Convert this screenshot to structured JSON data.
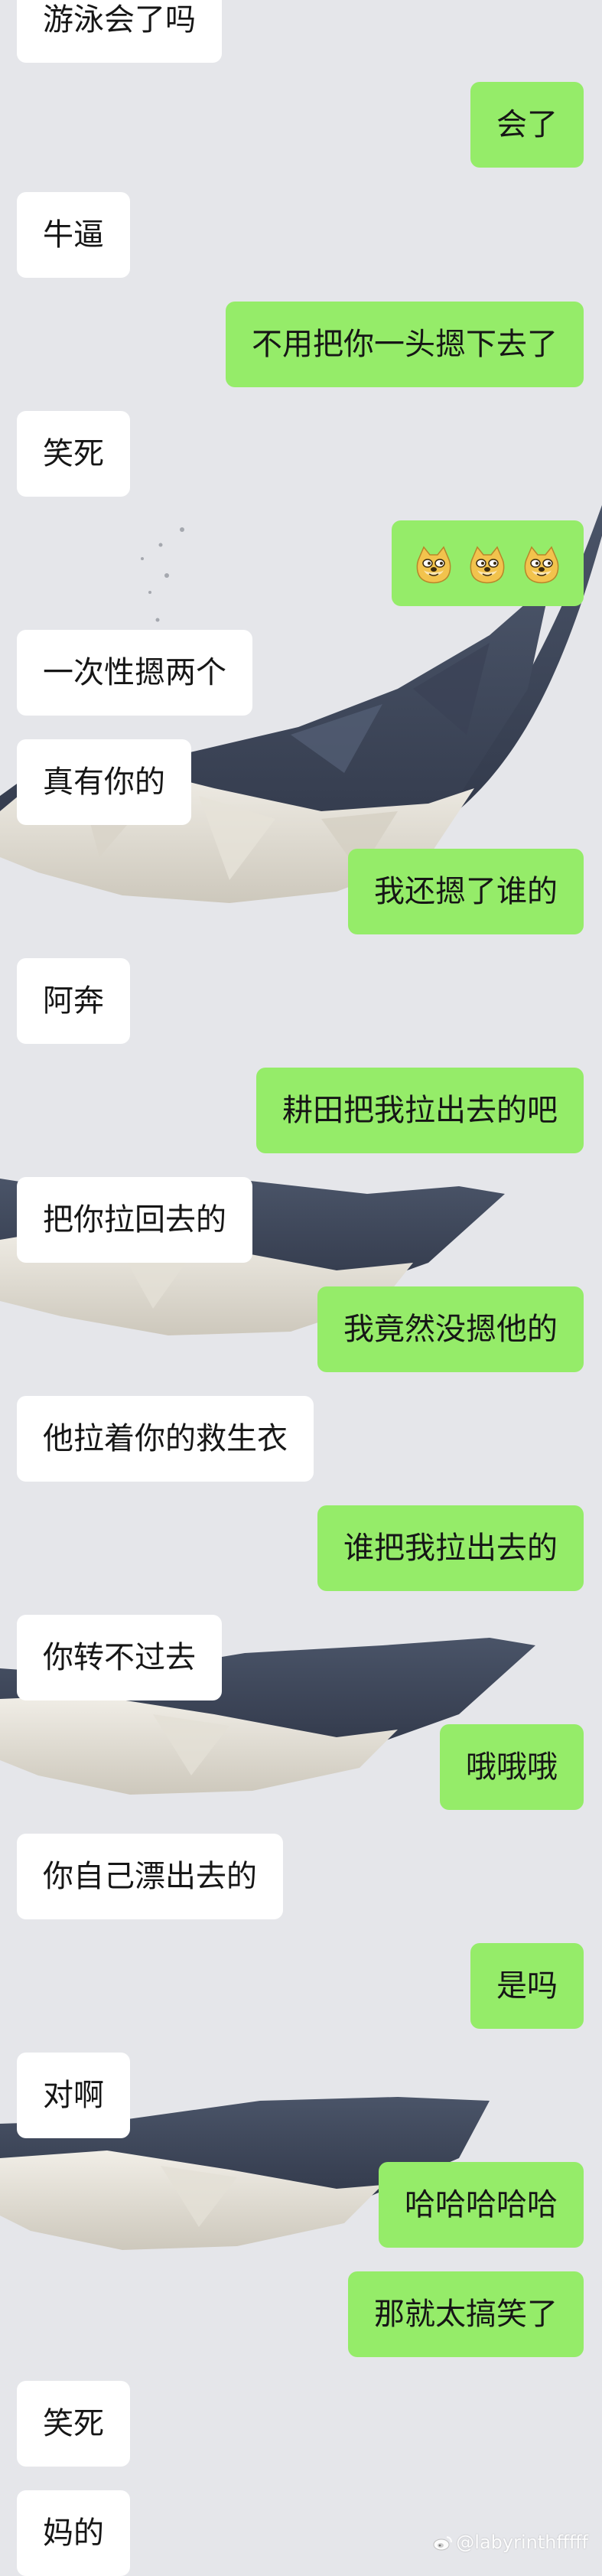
{
  "conversation": {
    "messages": [
      {
        "side": "left",
        "text": "游泳会了吗"
      },
      {
        "side": "right",
        "text": "会了"
      },
      {
        "side": "left",
        "text": "牛逼"
      },
      {
        "side": "right",
        "text": "不用把你一头摁下去了"
      },
      {
        "side": "left",
        "text": "笑死"
      },
      {
        "side": "right",
        "text": "",
        "emoji": [
          "doge-emoji",
          "doge-emoji",
          "doge-emoji"
        ]
      },
      {
        "side": "left",
        "text": "一次性摁两个"
      },
      {
        "side": "left",
        "text": "真有你的"
      },
      {
        "side": "right",
        "text": "我还摁了谁的"
      },
      {
        "side": "left",
        "text": "阿奔"
      },
      {
        "side": "right",
        "text": "耕田把我拉出去的吧"
      },
      {
        "side": "left",
        "text": "把你拉回去的"
      },
      {
        "side": "right",
        "text": "我竟然没摁他的"
      },
      {
        "side": "left",
        "text": "他拉着你的救生衣"
      },
      {
        "side": "right",
        "text": "谁把我拉出去的"
      },
      {
        "side": "left",
        "text": "你转不过去"
      },
      {
        "side": "right",
        "text": "哦哦哦"
      },
      {
        "side": "left",
        "text": "你自己漂出去的"
      },
      {
        "side": "right",
        "text": "是吗"
      },
      {
        "side": "left",
        "text": "对啊"
      },
      {
        "side": "right",
        "text": "哈哈哈哈哈"
      },
      {
        "side": "right",
        "text": "那就太搞笑了"
      },
      {
        "side": "left",
        "text": "笑死"
      },
      {
        "side": "left",
        "text": "妈的"
      }
    ]
  },
  "watermark": {
    "text": "@labyrinthfffff",
    "icon": "weibo-icon"
  },
  "colors": {
    "background": "#e5e6ea",
    "incoming_bubble": "#ffffff",
    "outgoing_bubble": "#95ec69",
    "text": "#161616",
    "whale_dark": "#3c4557",
    "whale_light": "#e8e4da"
  }
}
